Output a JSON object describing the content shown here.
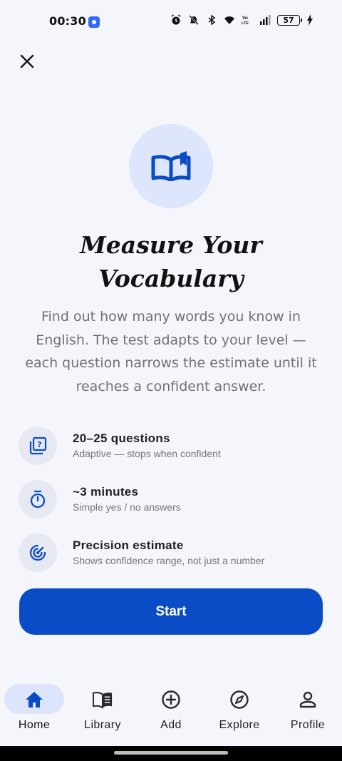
{
  "status_bar": {
    "time": "00:30",
    "battery": "57"
  },
  "close": {
    "icon": "close-icon"
  },
  "hero": {
    "icon": "open-book-icon"
  },
  "title_line1": "Measure Your",
  "title_line2": "Vocabulary",
  "description": "Find out how many words you know in English. The test adapts to your level — each question narrows the estimate until it reaches a confident answer.",
  "features": [
    {
      "icon": "quiz-icon",
      "title": "20–25 questions",
      "subtitle": "Adaptive — stops when confident"
    },
    {
      "icon": "timer-icon",
      "title": "~3 minutes",
      "subtitle": "Simple yes / no answers"
    },
    {
      "icon": "radar-target-icon",
      "title": "Precision estimate",
      "subtitle": "Shows confidence range, not just a number"
    }
  ],
  "start_label": "Start",
  "nav": [
    {
      "label": "Home",
      "icon": "home-icon",
      "active": true
    },
    {
      "label": "Library",
      "icon": "library-book-icon",
      "active": false
    },
    {
      "label": "Add",
      "icon": "add-circle-icon",
      "active": false
    },
    {
      "label": "Explore",
      "icon": "compass-icon",
      "active": false
    },
    {
      "label": "Profile",
      "icon": "person-icon",
      "active": false
    }
  ],
  "colors": {
    "accent": "#0a4cc6",
    "background": "#f5f6fb",
    "hero_circle": "#dde6fd",
    "nav_active_pill": "#dce5fb"
  }
}
